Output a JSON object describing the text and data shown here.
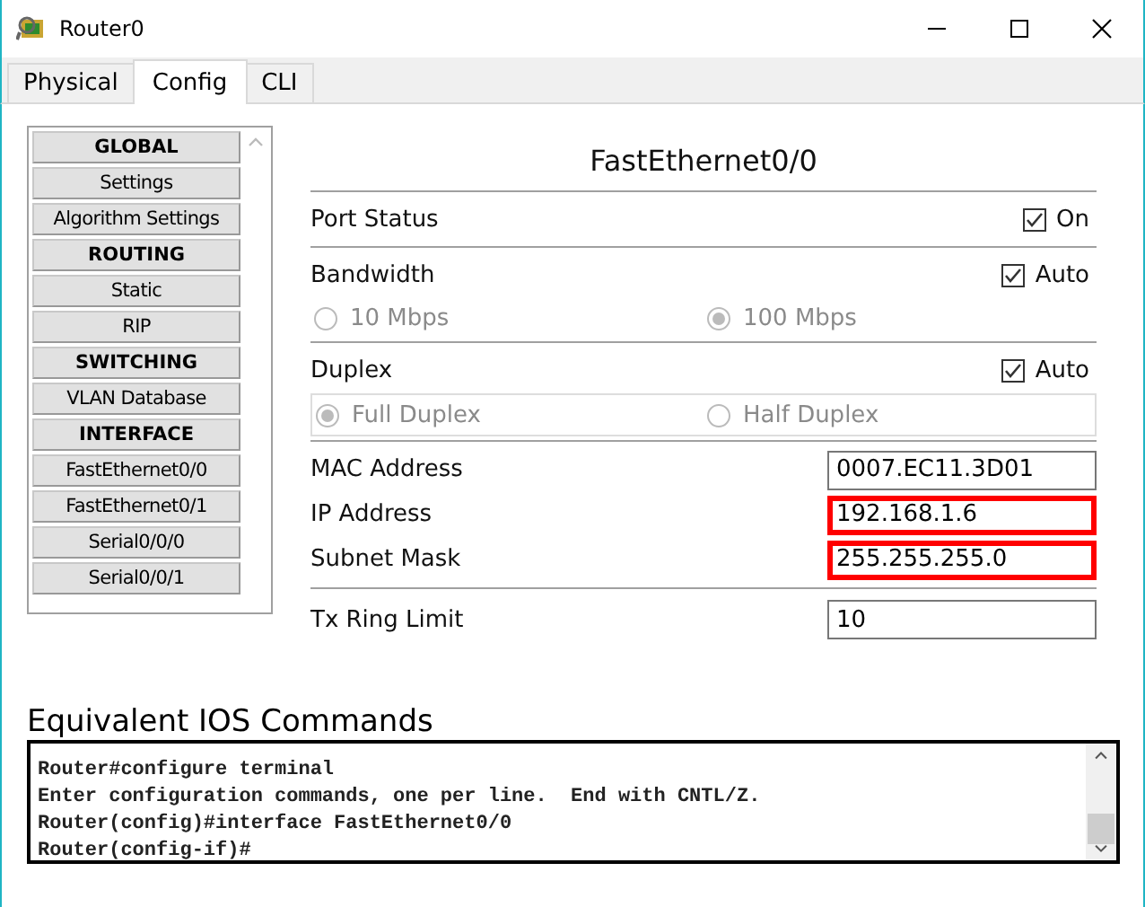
{
  "window": {
    "title": "Router0"
  },
  "tabs": [
    {
      "label": "Physical",
      "selected": false
    },
    {
      "label": "Config",
      "selected": true
    },
    {
      "label": "CLI",
      "selected": false
    }
  ],
  "sidebar": {
    "items": [
      {
        "label": "GLOBAL",
        "kind": "header"
      },
      {
        "label": "Settings",
        "kind": "item"
      },
      {
        "label": "Algorithm Settings",
        "kind": "item"
      },
      {
        "label": "ROUTING",
        "kind": "header"
      },
      {
        "label": "Static",
        "kind": "item"
      },
      {
        "label": "RIP",
        "kind": "item"
      },
      {
        "label": "SWITCHING",
        "kind": "header"
      },
      {
        "label": "VLAN Database",
        "kind": "item"
      },
      {
        "label": "INTERFACE",
        "kind": "header"
      },
      {
        "label": "FastEthernet0/0",
        "kind": "item"
      },
      {
        "label": "FastEthernet0/1",
        "kind": "item"
      },
      {
        "label": "Serial0/0/0",
        "kind": "item"
      },
      {
        "label": "Serial0/0/1",
        "kind": "item"
      }
    ]
  },
  "interface_panel": {
    "title": "FastEthernet0/0",
    "port_status": {
      "label": "Port Status",
      "option": "On",
      "checked": true
    },
    "bandwidth": {
      "label": "Bandwidth",
      "auto": {
        "label": "Auto",
        "checked": true
      },
      "options": [
        {
          "label": "10 Mbps",
          "selected": false,
          "disabled": true
        },
        {
          "label": "100 Mbps",
          "selected": true,
          "disabled": true
        }
      ]
    },
    "duplex": {
      "label": "Duplex",
      "auto": {
        "label": "Auto",
        "checked": true
      },
      "options": [
        {
          "label": "Full Duplex",
          "selected": true,
          "disabled": true
        },
        {
          "label": "Half Duplex",
          "selected": false,
          "disabled": true
        }
      ]
    },
    "fields": [
      {
        "label": "MAC Address",
        "value": "0007.EC11.3D01",
        "highlighted": false
      },
      {
        "label": "IP Address",
        "value": "192.168.1.6",
        "highlighted": true
      },
      {
        "label": "Subnet Mask",
        "value": "255.255.255.0",
        "highlighted": true
      }
    ],
    "tx_ring_limit": {
      "label": "Tx Ring Limit",
      "value": "10"
    }
  },
  "ios_commands": {
    "title": "Equivalent IOS Commands",
    "lines": [
      "Router#configure terminal",
      "Enter configuration commands, one per line.  End with CNTL/Z.",
      "Router(config)#interface FastEthernet0/0",
      "Router(config-if)#"
    ]
  }
}
